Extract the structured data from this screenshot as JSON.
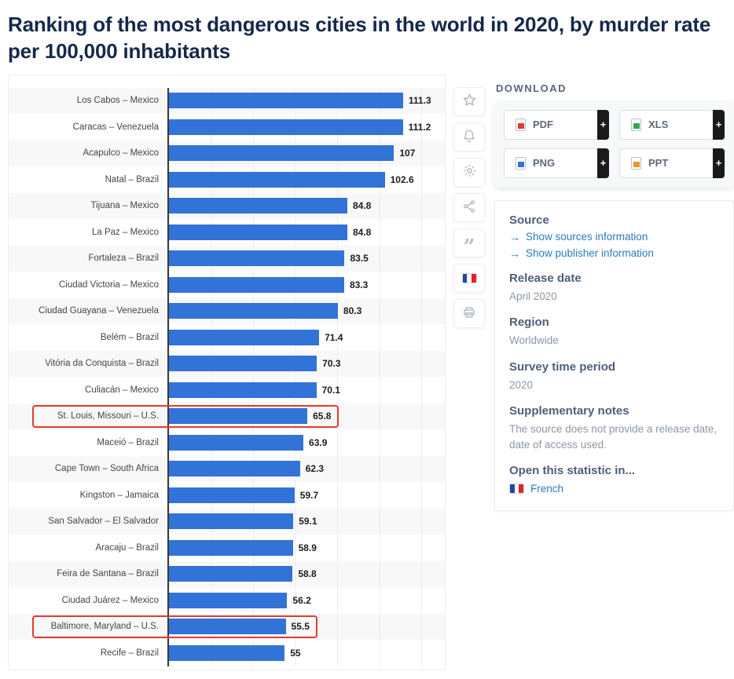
{
  "page": {
    "title": "Ranking of the most dangerous cities in the world in 2020, by murder rate per 100,000 inhabitants"
  },
  "chart_data": {
    "type": "bar",
    "orientation": "horizontal",
    "title": "Ranking of the most dangerous cities in the world in 2020, by murder rate per 100,000 inhabitants",
    "xlim": [
      0,
      120
    ],
    "gridline_step": 20,
    "grid": true,
    "bar_color": "#3273d8",
    "highlight_color": "#e53a30",
    "categories": [
      "Los Cabos – Mexico",
      "Caracas – Venezuela",
      "Acapulco – Mexico",
      "Natal – Brazil",
      "Tijuana – Mexico",
      "La Paz – Mexico",
      "Fortaleza – Brazil",
      "Ciudad Victoria – Mexico",
      "Ciudad Guayana – Venezuela",
      "Belém – Brazil",
      "Vitória da Conquista – Brazil",
      "Culiacán – Mexico",
      "St. Louis, Missouri – U.S.",
      "Maceió – Brazil",
      "Cape Town – South Africa",
      "Kingston – Jamaica",
      "San Salvador – El Salvador",
      "Aracaju – Brazil",
      "Feira de Santana – Brazil",
      "Ciudad Juárez – Mexico",
      "Baltimore, Maryland – U.S.",
      "Recife – Brazil"
    ],
    "values": [
      111.3,
      111.2,
      107,
      102.6,
      84.8,
      84.8,
      83.5,
      83.3,
      80.3,
      71.4,
      70.3,
      70.1,
      65.8,
      63.9,
      62.3,
      59.7,
      59.1,
      58.9,
      58.8,
      56.2,
      55.5,
      55
    ],
    "highlighted_indices": [
      12,
      20
    ],
    "highlighted_labels": [
      "St. Louis, Missouri – U.S.",
      "Baltimore, Maryland – U.S."
    ]
  },
  "toolbar": {
    "icons": [
      "star-icon",
      "bell-icon",
      "gear-icon",
      "share-icon",
      "quote-icon",
      "french-flag-icon",
      "print-icon"
    ]
  },
  "download": {
    "heading": "DOWNLOAD",
    "buttons": [
      {
        "label": "PDF",
        "color": "#e03c31"
      },
      {
        "label": "XLS",
        "color": "#33a852"
      },
      {
        "label": "PNG",
        "color": "#3273d8"
      },
      {
        "label": "PPT",
        "color": "#e8962e"
      }
    ]
  },
  "source_panel": {
    "source_heading": "Source",
    "links": [
      "Show sources information",
      "Show publisher information"
    ],
    "sections": [
      {
        "heading": "Release date",
        "text": "April 2020"
      },
      {
        "heading": "Region",
        "text": "Worldwide"
      },
      {
        "heading": "Survey time period",
        "text": "2020"
      },
      {
        "heading": "Supplementary notes",
        "text": "The source does not provide a release date, date of access used."
      }
    ],
    "open_in": {
      "heading": "Open this statistic in...",
      "language": "French"
    }
  }
}
